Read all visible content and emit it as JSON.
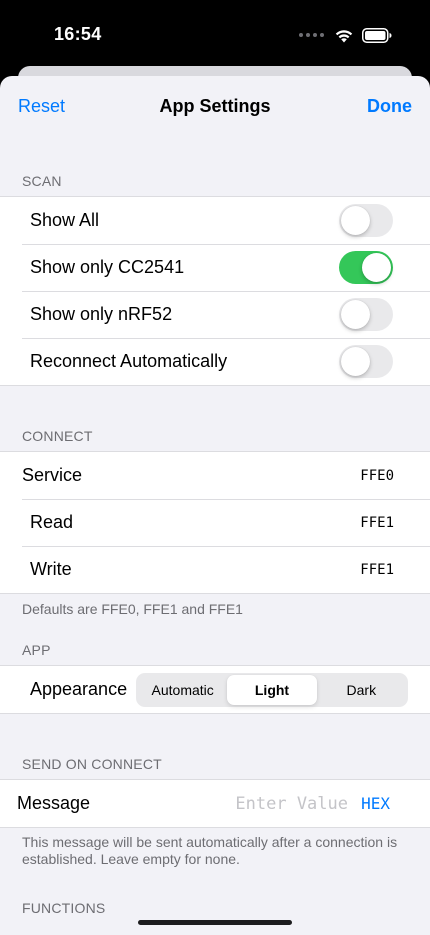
{
  "status_bar": {
    "time": "16:54",
    "icons": [
      "signal-icon",
      "wifi-icon",
      "battery-icon"
    ]
  },
  "nav": {
    "left_label": "Reset",
    "title": "App Settings",
    "right_label": "Done"
  },
  "colors": {
    "accent": "#007aff",
    "toggle_on": "#34c759",
    "toggle_off": "#e9e9eb",
    "background": "#f2f2f7",
    "secondary_text": "#6d6d72"
  },
  "scan": {
    "header": "SCAN",
    "items": [
      {
        "label": "Show All",
        "on": false
      },
      {
        "label": "Show only CC2541",
        "on": true
      },
      {
        "label": "Show only nRF52",
        "on": false
      },
      {
        "label": "Reconnect Automatically",
        "on": false
      }
    ]
  },
  "connect": {
    "header": "CONNECT",
    "rows": [
      {
        "label": "Service",
        "value": "FFE0"
      },
      {
        "label": "Read",
        "value": "FFE1"
      },
      {
        "label": "Write",
        "value": "FFE1"
      }
    ],
    "footer": "Defaults are FFE0, FFE1 and FFE1"
  },
  "app": {
    "header": "APP",
    "appearance_label": "Appearance",
    "options": [
      "Automatic",
      "Light",
      "Dark"
    ],
    "selected": "Light"
  },
  "send_on_connect": {
    "header": "SEND ON CONNECT",
    "message_label": "Message",
    "placeholder": "Enter Value",
    "value": "",
    "format_label": "HEX",
    "footer": "This message will be sent automatically after a connection is established. Leave empty for none."
  },
  "functions": {
    "header": "FUNCTIONS"
  }
}
